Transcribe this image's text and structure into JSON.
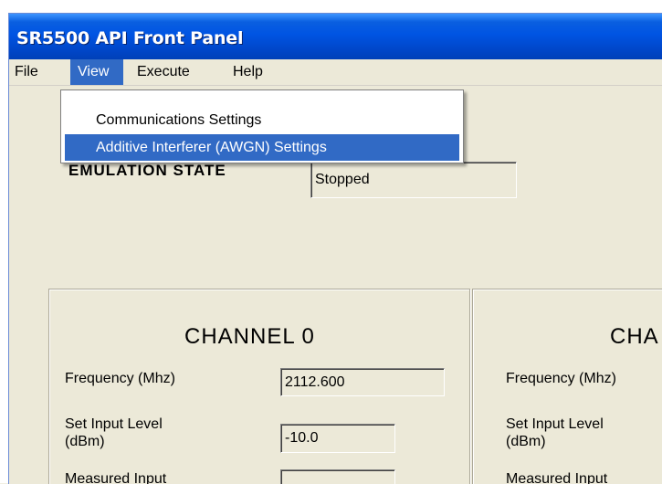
{
  "window": {
    "title": "SR5500 API Front Panel"
  },
  "menubar": {
    "file": "File",
    "view": "View",
    "execute": "Execute",
    "help": "Help"
  },
  "view_menu": {
    "items": [
      {
        "label": "Communications Settings"
      },
      {
        "label": "Additive Interferer (AWGN)  Settings"
      }
    ]
  },
  "emulation": {
    "label": "EMULATION STATE",
    "value": "Stopped"
  },
  "channel0": {
    "title": "CHANNEL 0",
    "frequency_label": "Frequency (Mhz)",
    "frequency_value": "2112.600",
    "input_level_label_line1": "Set Input Level",
    "input_level_label_line2": "(dBm)",
    "input_level_value": "-10.0",
    "measured_input_label": "Measured Input",
    "measured_input_value": ""
  },
  "channel1": {
    "title": "CHA",
    "frequency_label": "Frequency (Mhz)",
    "input_level_label_line1": "Set Input Level",
    "input_level_label_line2": "(dBm)",
    "measured_input_label": "Measured Input"
  }
}
